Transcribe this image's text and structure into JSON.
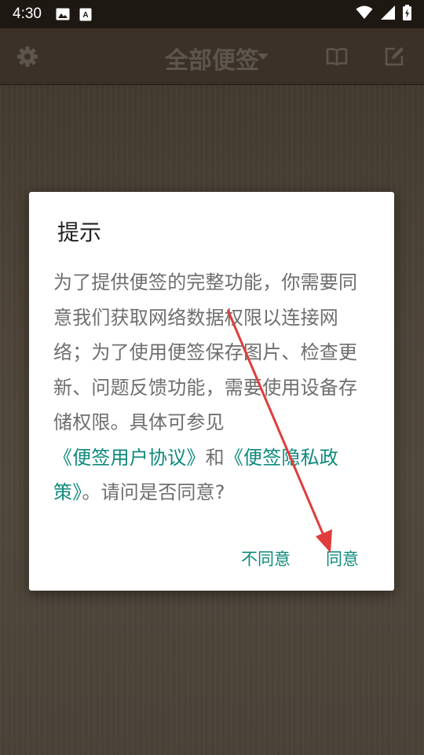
{
  "status_bar": {
    "time": "4:30",
    "left_icons": [
      "image-icon",
      "a-badge-icon"
    ],
    "right_icons": [
      "wifi-icon",
      "signal-icon",
      "battery-charging-icon"
    ]
  },
  "app_bar": {
    "title": "全部便签",
    "icons": [
      "gear-icon",
      "book-icon",
      "edit-icon"
    ]
  },
  "dialog": {
    "title": "提示",
    "body_part1": "为了提供便签的完整功能，你需要同意我们获取网络数据权限以连接网络；为了使用便签保存图片、检查更新、问题反馈功能，需要使用设备存储权限。具体可参见",
    "link_user_agreement": "《便签用户协议》",
    "body_and": "和",
    "link_privacy_policy": "《便签隐私政策》",
    "body_part2": "。请问是否同意?",
    "disagree_label": "不同意",
    "agree_label": "同意"
  },
  "colors": {
    "accent": "#0e8a7c",
    "annotation": "#e03c3c",
    "status_bar": "#1e1813",
    "app_bar": "#3b3128"
  }
}
